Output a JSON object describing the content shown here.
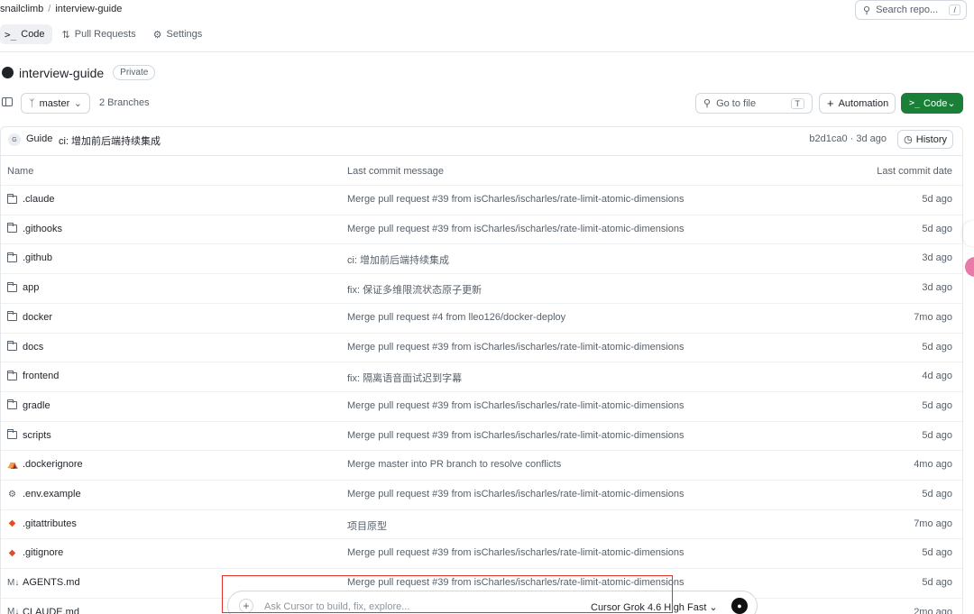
{
  "breadcrumb": {
    "owner": "snailclimb",
    "separator": "/",
    "repo": "interview-guide"
  },
  "search": {
    "placeholder": "Search repo...",
    "shortcut": "/"
  },
  "tabs": [
    {
      "label": "Code",
      "icon": "terminal-icon",
      "active": true
    },
    {
      "label": "Pull Requests",
      "icon": "pull-request-icon"
    },
    {
      "label": "Settings",
      "icon": "gear-icon"
    }
  ],
  "repo": {
    "name": "interview-guide",
    "visibility": "Private"
  },
  "toolbar": {
    "branch": "master",
    "branches_count": "2 Branches",
    "go_to_file": "Go to file",
    "go_to_file_key": "T",
    "automation": "Automation",
    "code": "Code"
  },
  "last_commit": {
    "avatar_initial": "G",
    "author": "Guide",
    "message": "ci: 增加前后端持续集成",
    "meta": "b2d1ca0 · 3d ago",
    "history": "History"
  },
  "table": {
    "headers": {
      "name": "Name",
      "message": "Last commit message",
      "date": "Last commit date"
    },
    "rows": [
      {
        "name": ".claude",
        "icon": "folder-icon",
        "message": "Merge pull request #39 from isCharles/ischarles/rate-limit-atomic-dimensions",
        "date": "5d ago"
      },
      {
        "name": ".githooks",
        "icon": "folder-icon",
        "message": "Merge pull request #39 from isCharles/ischarles/rate-limit-atomic-dimensions",
        "date": "5d ago"
      },
      {
        "name": ".github",
        "icon": "folder-icon",
        "message": "ci: 增加前后端持续集成",
        "date": "3d ago"
      },
      {
        "name": "app",
        "icon": "folder-icon",
        "message": "fix: 保证多维限流状态原子更新",
        "date": "3d ago"
      },
      {
        "name": "docker",
        "icon": "folder-icon",
        "message": "Merge pull request #4 from lleo126/docker-deploy",
        "date": "7mo ago"
      },
      {
        "name": "docs",
        "icon": "folder-icon",
        "message": "Merge pull request #39 from isCharles/ischarles/rate-limit-atomic-dimensions",
        "date": "5d ago"
      },
      {
        "name": "frontend",
        "icon": "folder-icon",
        "message": "fix: 隔离语音面试迟到字幕",
        "date": "4d ago"
      },
      {
        "name": "gradle",
        "icon": "folder-icon",
        "message": "Merge pull request #39 from isCharles/ischarles/rate-limit-atomic-dimensions",
        "date": "5d ago"
      },
      {
        "name": "scripts",
        "icon": "folder-icon",
        "message": "Merge pull request #39 from isCharles/ischarles/rate-limit-atomic-dimensions",
        "date": "5d ago"
      },
      {
        "name": ".dockerignore",
        "icon": "docker-icon",
        "message": "Merge master into PR branch to resolve conflicts",
        "date": "4mo ago"
      },
      {
        "name": ".env.example",
        "icon": "gear-icon",
        "message": "Merge pull request #39 from isCharles/ischarles/rate-limit-atomic-dimensions",
        "date": "5d ago"
      },
      {
        "name": ".gitattributes",
        "icon": "git-icon",
        "message": "项目原型",
        "date": "7mo ago"
      },
      {
        "name": ".gitignore",
        "icon": "git-icon",
        "message": "Merge pull request #39 from isCharles/ischarles/rate-limit-atomic-dimensions",
        "date": "5d ago"
      },
      {
        "name": "AGENTS.md",
        "icon": "markdown-icon",
        "message": "Merge pull request #39 from isCharles/ischarles/rate-limit-atomic-dimensions",
        "date": "5d ago"
      },
      {
        "name": "CLAUDE.md",
        "icon": "markdown-icon",
        "message": "",
        "date": "2mo ago"
      }
    ]
  },
  "prompt": {
    "placeholder": "Ask Cursor to build, fix, explore...",
    "model": "Cursor Grok 4.6 High Fast ⌄"
  },
  "colors": {
    "accent_green": "#1a7f37",
    "highlight_red": "#e3312b",
    "git_icon": "#e34c26",
    "docker_icon": "#2496ed"
  }
}
